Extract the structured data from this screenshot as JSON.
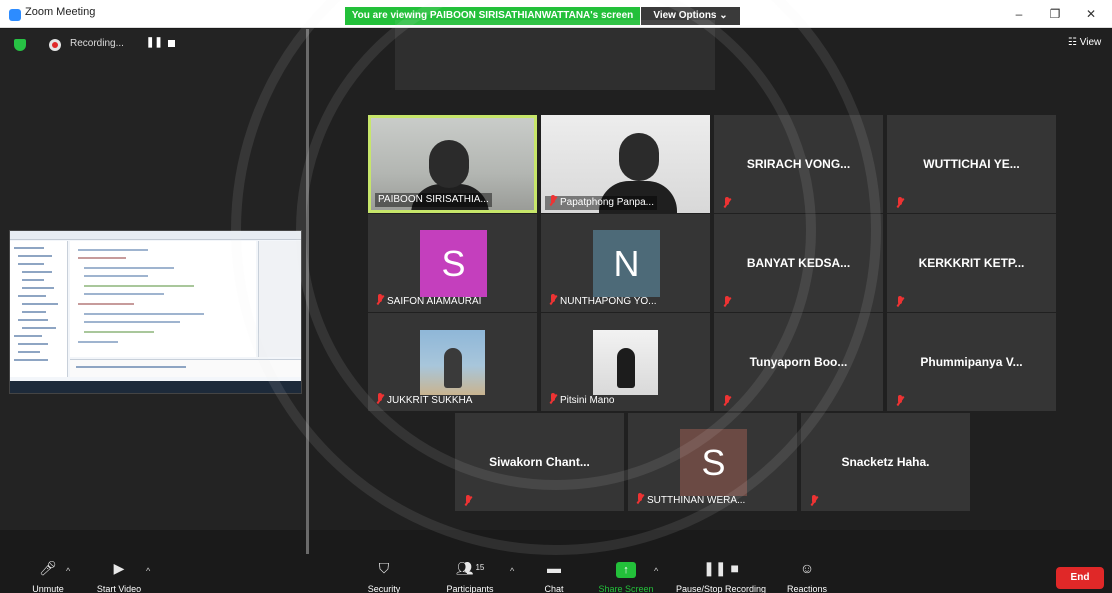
{
  "window": {
    "title": "Zoom Meeting",
    "banner": "You are viewing PAIBOON SIRISATHIANWATTANA's screen",
    "view_options": "View Options ⌄",
    "minimize": "–",
    "restore": "❐",
    "close": "✕"
  },
  "recording": {
    "label": "Recording...",
    "pause": "❚❚"
  },
  "view_button": "☷ View",
  "tiles": [
    {
      "kind": "video",
      "label": "PAIBOON SIRISATHIA...",
      "active": true,
      "muted": false
    },
    {
      "kind": "video",
      "label": "Papatphong Panpa...",
      "muted": true
    },
    {
      "kind": "name",
      "name": "SRIRACH VONG...",
      "muted": true
    },
    {
      "kind": "name",
      "name": "WUTTICHAI YE...",
      "muted": true
    },
    {
      "kind": "avatar",
      "initial": "S",
      "color": "#c43fbd",
      "label": "SAIFON AIAMAURAI",
      "muted": true
    },
    {
      "kind": "avatar",
      "initial": "N",
      "color": "#4d6a78",
      "label": "NUNTHAPONG YO...",
      "muted": true
    },
    {
      "kind": "name",
      "name": "BANYAT KEDSA...",
      "muted": true
    },
    {
      "kind": "name",
      "name": "KERKKRIT KETP...",
      "muted": true
    },
    {
      "kind": "photo",
      "label": "JUKKRIT SUKKHA",
      "muted": true
    },
    {
      "kind": "photo",
      "label": "Pitsini Mano",
      "muted": true
    },
    {
      "kind": "name",
      "name": "Tunyaporn Boo...",
      "muted": true
    },
    {
      "kind": "name",
      "name": "Phummipanya V...",
      "muted": true
    },
    {
      "kind": "name",
      "name": "Siwakorn Chant...",
      "muted": true
    },
    {
      "kind": "avatar",
      "initial": "S",
      "color": "#6b4a44",
      "label": "SUTTHINAN WERA...",
      "muted": true
    },
    {
      "kind": "name",
      "name": "Snacketz Haha.",
      "muted": true
    }
  ],
  "toolbar": {
    "unmute": "Unmute",
    "start_video": "Start Video",
    "security": "Security",
    "participants": "Participants",
    "participant_count": "15",
    "chat": "Chat",
    "share_screen": "Share Screen",
    "pause_stop": "Pause/Stop Recording",
    "reactions": "Reactions",
    "end": "End"
  },
  "colors": {
    "share_green": "#23c03a",
    "end_red": "#e02828",
    "active_border": "#c7e66a",
    "tile_bg": "#353535"
  }
}
